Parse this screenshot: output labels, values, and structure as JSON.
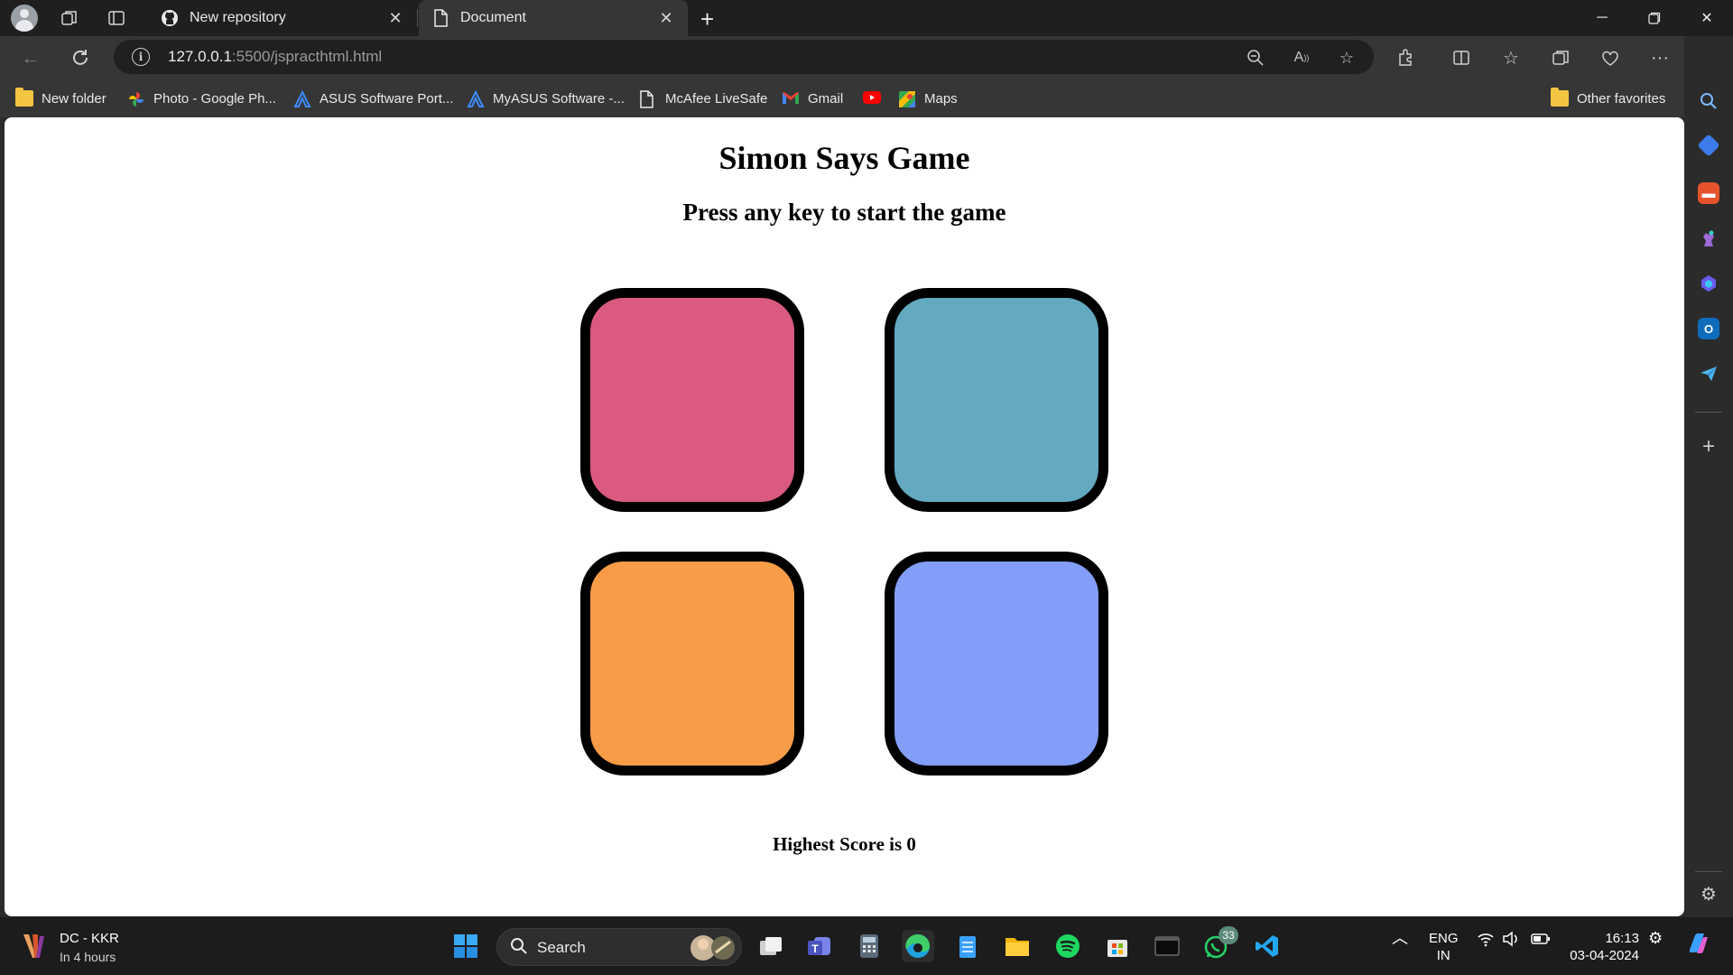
{
  "browser": {
    "tabs": [
      {
        "label": "New repository",
        "icon": "github-icon"
      },
      {
        "label": "Document",
        "icon": "document-icon",
        "active": true
      }
    ],
    "url_host": "127.0.0.1",
    "url_rest": ":5500/jspracthtml.html",
    "bookmarks": [
      {
        "label": "New folder",
        "icon": "folder-icon"
      },
      {
        "label": "Photo - Google Ph...",
        "icon": "google-photos-icon"
      },
      {
        "label": "ASUS Software Port...",
        "icon": "asus-icon"
      },
      {
        "label": "MyASUS Software -...",
        "icon": "asus-icon"
      },
      {
        "label": "McAfee LiveSafe",
        "icon": "document-icon"
      },
      {
        "label": "Gmail",
        "icon": "gmail-icon"
      },
      {
        "label": "",
        "icon": "youtube-icon"
      },
      {
        "label": "Maps",
        "icon": "maps-icon"
      }
    ],
    "other_favorites": "Other favorites"
  },
  "page": {
    "title": "Simon Says Game",
    "subtitle": "Press any key to start the game",
    "buttons": [
      {
        "color": "#DA5A80"
      },
      {
        "color": "#63A9C0"
      },
      {
        "color": "#F89C47"
      },
      {
        "color": "#829EF8"
      }
    ],
    "score_text": "Highest Score is 0"
  },
  "taskbar": {
    "weather_title": "DC - KKR",
    "weather_sub": "In 4 hours",
    "search_label": "Search",
    "whatsapp_badge": "33",
    "lang_top": "ENG",
    "lang_bottom": "IN",
    "time": "16:13",
    "date": "03-04-2024"
  }
}
